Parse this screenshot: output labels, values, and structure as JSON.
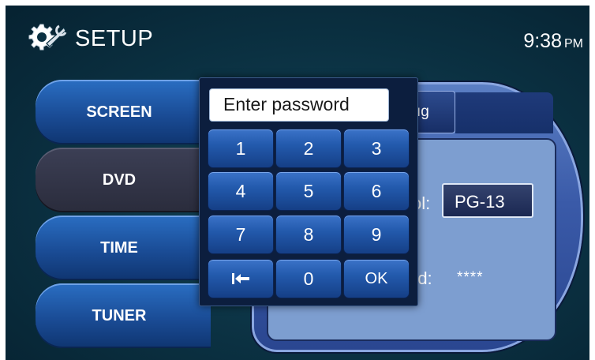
{
  "header": {
    "title": "SETUP",
    "time": "9:38",
    "ampm": "PM",
    "icon": "gear-wrench-icon"
  },
  "sidebar": {
    "items": [
      {
        "label": "SCREEN",
        "active": false
      },
      {
        "label": "DVD",
        "active": true
      },
      {
        "label": "TIME",
        "active": false
      },
      {
        "label": "TUNER",
        "active": false
      }
    ]
  },
  "right_panel": {
    "tab_label": "ıg",
    "parental_label": "ol:",
    "rating_value": "PG-13",
    "password_label": "rd:",
    "password_value": "****"
  },
  "keypad": {
    "placeholder": "Enter password",
    "keys": [
      "1",
      "2",
      "3",
      "4",
      "5",
      "6",
      "7",
      "8",
      "9",
      "backspace",
      "0",
      "OK"
    ],
    "backspace_icon": "backspace-arrow-icon"
  },
  "colors": {
    "background": "#0b3142",
    "menu_blue": "#1a4c96",
    "menu_active": "#2a2c3c",
    "key_blue": "#235aad",
    "panel_light": "#7d9ed0"
  }
}
